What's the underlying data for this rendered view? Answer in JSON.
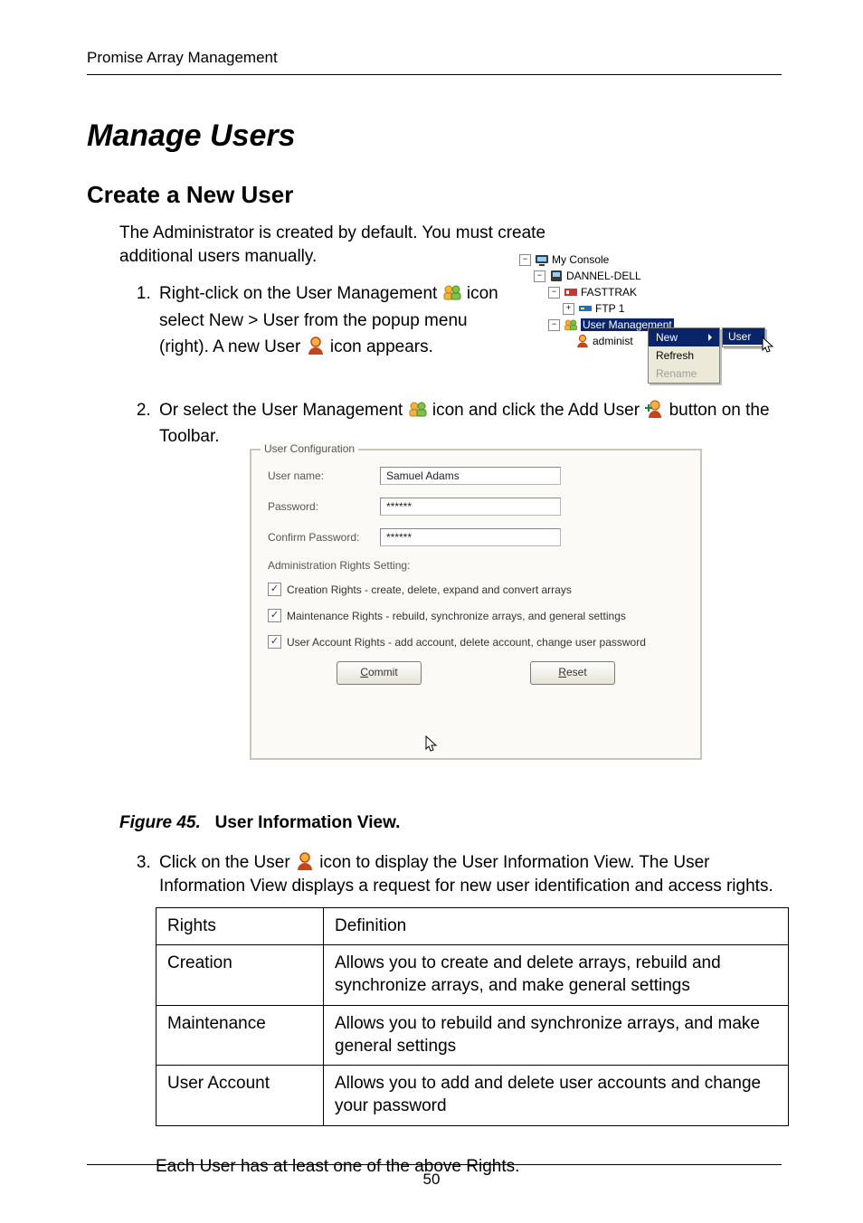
{
  "header": {
    "running": "Promise Array Management"
  },
  "titles": {
    "h1": "Manage Users",
    "h2": "Create a New User"
  },
  "intro": "The Administrator is created by default. You must create additional users manually.",
  "steps": {
    "s1a": "Right-click on the User Management ",
    "s1b": " icon select New > User from the popup menu (right). A new User ",
    "s1c": " icon appears.",
    "s2a": "Or select the User Management ",
    "s2b": " icon and click the Add User ",
    "s2c": " button on the Toolbar.",
    "s3": "Click on the User  icon to display the User Information View. The User Information View displays a request for new user identification and access rights."
  },
  "figure": {
    "lead": "Figure 45.",
    "title": "User Information View."
  },
  "table": {
    "head": {
      "c1": "Rights",
      "c2": "Definition"
    },
    "rows": [
      {
        "c1": "Creation",
        "c2": "Allows you to create and delete arrays, rebuild and synchronize arrays, and make general settings"
      },
      {
        "c1": "Maintenance",
        "c2": "Allows you to rebuild and synchronize arrays, and make general settings"
      },
      {
        "c1": "User Account",
        "c2": "Allows you to add and delete user accounts and change your password"
      }
    ]
  },
  "after_table": "Each User has at least one of the above Rights.",
  "page_number": "50",
  "tree": {
    "root": "My Console",
    "host": "DANNEL-DELL",
    "ctrl": "FASTTRAK",
    "chan": "FTP 1",
    "um": "User Management",
    "user": "administ",
    "menu": {
      "new": "New",
      "refresh": "Refresh",
      "rename": "Rename",
      "sub_user": "User"
    }
  },
  "dialog": {
    "group": "User Configuration",
    "labels": {
      "username": "User name:",
      "password": "Password:",
      "confirm": "Confirm Password:"
    },
    "values": {
      "username": "Samuel Adams",
      "password": "******",
      "confirm": "******"
    },
    "rights_header": "Administration Rights Setting:",
    "rights": [
      "Creation Rights - create, delete, expand and convert arrays",
      "Maintenance Rights - rebuild, synchronize arrays, and general settings",
      "User Account Rights - add account, delete account, change user password"
    ],
    "buttons": {
      "commit": "Commit",
      "reset": "Reset"
    }
  },
  "icons": {
    "user_mgmt": "user-management-icon",
    "user": "user-icon",
    "add_user": "add-user-icon"
  }
}
